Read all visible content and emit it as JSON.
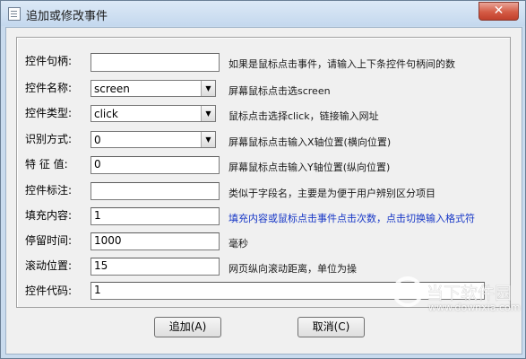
{
  "window": {
    "title": "追加或修改事件",
    "close_label": "✕"
  },
  "fields": [
    {
      "label": "控件句柄:",
      "value": "",
      "desc": "如果是鼠标点击事件，请输入上下条控件句柄间的数"
    },
    {
      "label": "控件名称:",
      "value": "screen",
      "desc": "屏幕鼠标点击选screen"
    },
    {
      "label": "控件类型:",
      "value": "click",
      "desc": "鼠标点击选择click，链接输入网址"
    },
    {
      "label": "识别方式:",
      "value": "0",
      "desc": "屏幕鼠标点击输入X轴位置(横向位置)"
    },
    {
      "label": "特 征 值:",
      "value": "0",
      "desc": "屏幕鼠标点击输入Y轴位置(纵向位置)"
    },
    {
      "label": "控件标注:",
      "value": "",
      "desc": "类似于字段名，主要是为便于用户辨别区分项目"
    },
    {
      "label": "填充内容:",
      "value": "1",
      "desc": "填充内容或鼠标点击事件点击次数，点击切换输入格式符"
    },
    {
      "label": "停留时间:",
      "value": "1000",
      "desc": "毫秒"
    },
    {
      "label": "滚动位置:",
      "value": "15",
      "desc": "网页纵向滚动距离，单位为操"
    },
    {
      "label": "控件代码:",
      "value": "1"
    }
  ],
  "buttons": {
    "add": "追加(A)",
    "cancel": "取消(C)"
  },
  "watermark": {
    "brand": "当下软件园",
    "url": "www.downxia.com"
  },
  "colors": {
    "link": "#1636c6",
    "close": "#c1402c",
    "titlebar": "#c4d8ee"
  }
}
